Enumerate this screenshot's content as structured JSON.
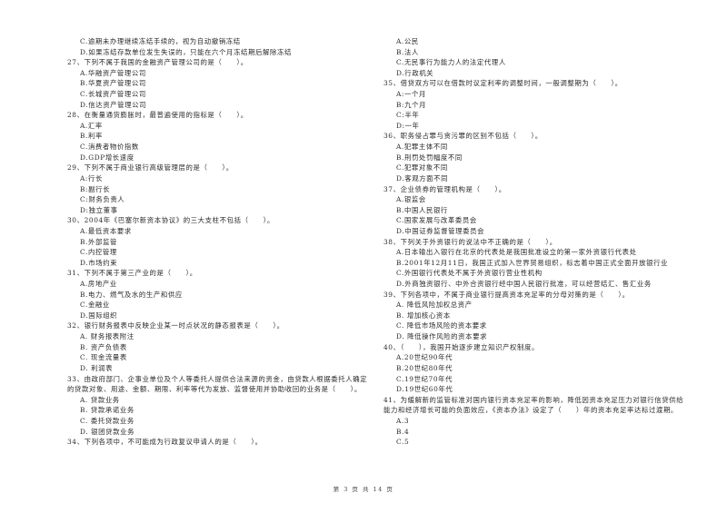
{
  "document": {
    "left_column": [
      {
        "type": "opt",
        "text": "C.逾期未办理继续冻结手续的，视为自动撤销冻结"
      },
      {
        "type": "opt",
        "text": "D.如果冻结存款单位发生失误的，只能在六个月冻结期后解除冻结"
      },
      {
        "type": "q",
        "text": "27、下列不属于我国的金融资产管理公司的是（　　）。"
      },
      {
        "type": "opt",
        "text": "A.华融资产管理公司"
      },
      {
        "type": "opt",
        "text": "B.华夏资产管理公司"
      },
      {
        "type": "opt",
        "text": "C.长城资产管理公司"
      },
      {
        "type": "opt",
        "text": "D.信达资产管理公司"
      },
      {
        "type": "q",
        "text": "28、在衡量通货膨胀时，最普遍使用的指标是（　　）。"
      },
      {
        "type": "opt",
        "text": "A.汇率"
      },
      {
        "type": "opt",
        "text": "B.利率"
      },
      {
        "type": "opt",
        "text": "C.消费者物价指数"
      },
      {
        "type": "opt",
        "text": "D.GDP增长速度"
      },
      {
        "type": "q",
        "text": "29、下列不属于商业银行高级管理层的是（　　）。"
      },
      {
        "type": "opt",
        "text": "A:行长"
      },
      {
        "type": "opt",
        "text": "B:副行长"
      },
      {
        "type": "opt",
        "text": "C:财务负责人"
      },
      {
        "type": "opt",
        "text": "D:独立董事"
      },
      {
        "type": "q",
        "text": "30、2004年《巴塞尔新资本协议》的三大支柱不包括（　　）。"
      },
      {
        "type": "opt",
        "text": "A.最低资本要求"
      },
      {
        "type": "opt",
        "text": "B.外部监管"
      },
      {
        "type": "opt",
        "text": "C.内控管理"
      },
      {
        "type": "opt",
        "text": "D.市场约束"
      },
      {
        "type": "q",
        "text": "31、下列不属于第三产业的是（　　）。"
      },
      {
        "type": "opt",
        "text": "A.房地产业"
      },
      {
        "type": "opt",
        "text": "B.电力、燃气及水的生产和供应"
      },
      {
        "type": "opt",
        "text": "C.金融业"
      },
      {
        "type": "opt",
        "text": "D.国际组织"
      },
      {
        "type": "q",
        "text": "32、银行财务报表中反映企业某一时点状况的静态报表是（　　）。"
      },
      {
        "type": "opt",
        "text": "A. 财务报表附注"
      },
      {
        "type": "opt",
        "text": "B. 资产负债表"
      },
      {
        "type": "opt",
        "text": "C. 现金流量表"
      },
      {
        "type": "opt",
        "text": "D. 利润表"
      },
      {
        "type": "q",
        "text": "33、由政府部门、企事业单位及个人等委托人提供合法来源的资金，由贷款人根据委托人确定"
      },
      {
        "type": "cont",
        "text": "的贷款对象、用途、金额、期限、利率等代为发放、监督使用并协助收回的业务是（　　）。"
      },
      {
        "type": "opt",
        "text": "A. 贷款业务"
      },
      {
        "type": "opt",
        "text": "B. 贷款承诺业务"
      },
      {
        "type": "opt",
        "text": "C. 委托贷款业务"
      },
      {
        "type": "opt",
        "text": "D. 银团贷款业务"
      },
      {
        "type": "q",
        "text": "34、下列各项中，不可能成为行政复议申请人的是（　　）。"
      }
    ],
    "right_column": [
      {
        "type": "opt",
        "text": "A.公民"
      },
      {
        "type": "opt",
        "text": "B.法人"
      },
      {
        "type": "opt",
        "text": "C.无民事行为能力人的法定代理人"
      },
      {
        "type": "opt",
        "text": "D.行政机关"
      },
      {
        "type": "q",
        "text": "35、借贷双方可以在借款时议定利率的调整时间，一般调整期为（　　）。"
      },
      {
        "type": "opt",
        "text": "A:一个月"
      },
      {
        "type": "opt",
        "text": "B:九个月"
      },
      {
        "type": "opt",
        "text": "C:半年"
      },
      {
        "type": "opt",
        "text": "D:一年"
      },
      {
        "type": "q",
        "text": "36、职务侵占罪与贪污罪的区别不包括（　　）。"
      },
      {
        "type": "opt",
        "text": "A.犯罪主体不同"
      },
      {
        "type": "opt",
        "text": "B.刑罚处罚幅度不同"
      },
      {
        "type": "opt",
        "text": "C.犯罪对象不同"
      },
      {
        "type": "opt",
        "text": "D.客观方面不同"
      },
      {
        "type": "q",
        "text": "37、企业债券的管理机构是（　　）。"
      },
      {
        "type": "opt",
        "text": "A.银监会"
      },
      {
        "type": "opt",
        "text": "B.中国人民银行"
      },
      {
        "type": "opt",
        "text": "C.国家发展与改革委员会"
      },
      {
        "type": "opt",
        "text": "D.中国证券监督管理委员会"
      },
      {
        "type": "q",
        "text": "38、下列关于外资银行的说法中不正确的是（　　）。"
      },
      {
        "type": "opt",
        "text": "A.日本输出入银行在北京的代表处是我国批准设立的第一家外资银行代表处"
      },
      {
        "type": "opt",
        "text": "B.2001年12月11日，我国正式加入世界贸易组织，标志着中国正式全面开放银行业"
      },
      {
        "type": "opt",
        "text": "C.外国银行代表处不属于外资银行营业性机构"
      },
      {
        "type": "opt",
        "text": "D.外商独资银行、中外合资银行经中国人民银行批准，可以经营结汇、售汇业务"
      },
      {
        "type": "q",
        "text": "39、下列各项中，不属于商业银行提高资本充足率的分母对策的是（　　）。"
      },
      {
        "type": "opt",
        "text": "A. 降低风险加权总资产"
      },
      {
        "type": "opt",
        "text": "B. 增加核心资本"
      },
      {
        "type": "opt",
        "text": "C. 降低市场风险的资本要求"
      },
      {
        "type": "opt",
        "text": "D. 降低操作风险的资本要求"
      },
      {
        "type": "q",
        "text": "40、（　　），我国开始逐步建立知识产权制度。"
      },
      {
        "type": "opt",
        "text": "A.20世纪90年代"
      },
      {
        "type": "opt",
        "text": "B.20世纪80年代"
      },
      {
        "type": "opt",
        "text": "C.19世纪70年代"
      },
      {
        "type": "opt",
        "text": "D.19世纪60年代"
      },
      {
        "type": "q",
        "text": "41、为缓解新的监管标准对国内银行资本充足率的影响，降低因资本充足压力对银行信贷供给"
      },
      {
        "type": "cont",
        "text": "能力和经济增长可能的负面效应，《资本办法》设定了（　　）年的资本充足率达标过渡期。"
      },
      {
        "type": "opt",
        "text": "A.3"
      },
      {
        "type": "opt",
        "text": "B.4"
      },
      {
        "type": "opt",
        "text": "C.5"
      }
    ],
    "footer": "第 3 页 共 14 页"
  }
}
